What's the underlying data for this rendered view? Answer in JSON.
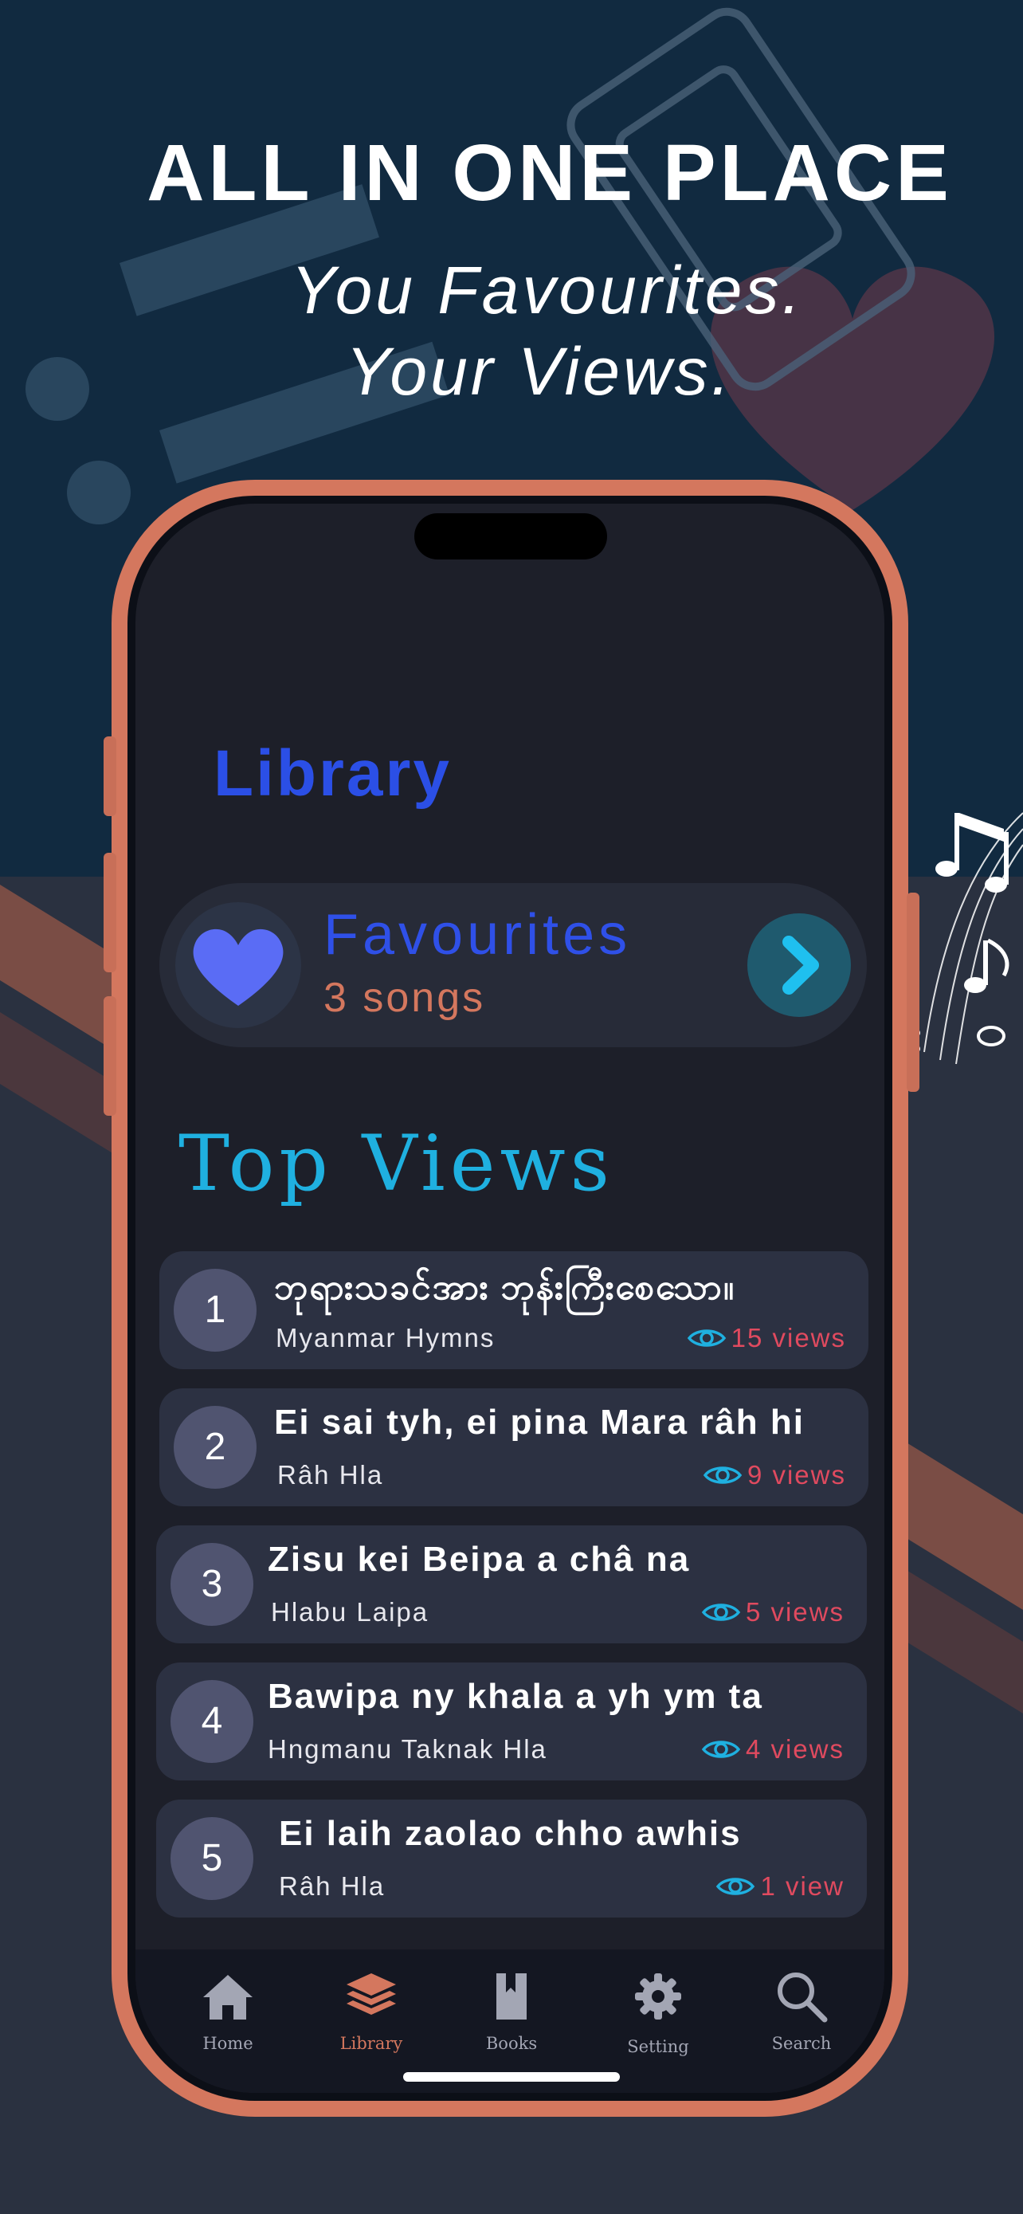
{
  "promo": {
    "headline": "ALL IN ONE PLACE",
    "subline_1": "You Favourites.",
    "subline_2": "Your Views."
  },
  "colors": {
    "accent_blue": "#2b4fe6",
    "accent_orange": "#d4775e",
    "accent_cyan": "#1fb0e0",
    "views_red": "#e04a5f",
    "background_navy": "#112a40"
  },
  "library": {
    "title": "Library",
    "favourites": {
      "label": "Favourites",
      "count": "3 songs",
      "icon": "heart-icon",
      "action_icon": "chevron-right-icon"
    }
  },
  "top_views": {
    "title": "Top Views",
    "items": [
      {
        "rank": "1",
        "title": "ဘုရားသခင်အား ဘုန်းကြီးစေသော။",
        "artist": "Myanmar Hymns",
        "views": "15 views"
      },
      {
        "rank": "2",
        "title": "Ei sai tyh, ei pina Mara râh hi",
        "artist": "Râh Hla",
        "views": "9 views"
      },
      {
        "rank": "3",
        "title": "Zisu kei Beipa a châ na",
        "artist": "Hlabu Laipa",
        "views": "5 views"
      },
      {
        "rank": "4",
        "title": "Bawipa ny khala a yh ym ta",
        "artist": "Hngmanu Taknak Hla",
        "views": "4 views"
      },
      {
        "rank": "5",
        "title": "Ei laih zaolao chho awhis",
        "artist": "Râh Hla",
        "views": "1 view"
      }
    ]
  },
  "tabbar": {
    "active": "Library",
    "tabs": [
      {
        "label": "Home",
        "icon": "home-icon"
      },
      {
        "label": "Library",
        "icon": "layers-icon"
      },
      {
        "label": "Books",
        "icon": "book-icon"
      },
      {
        "label": "Setting",
        "icon": "gear-icon"
      },
      {
        "label": "Search",
        "icon": "search-icon"
      }
    ]
  }
}
